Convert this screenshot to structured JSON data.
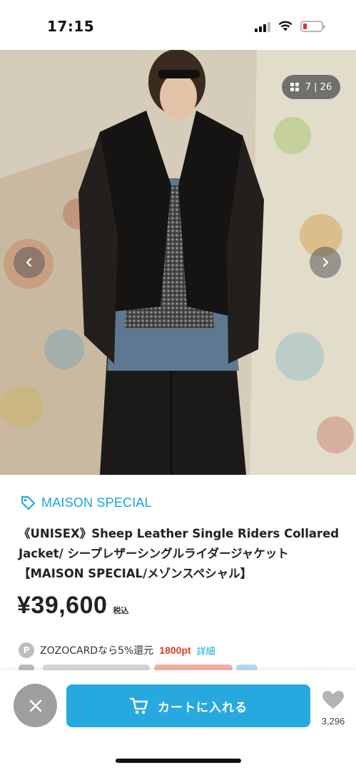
{
  "status_bar": {
    "time": "17:15"
  },
  "gallery": {
    "counter": "7 | 26",
    "icons": [
      "grid-icon",
      "chevron-left-icon",
      "chevron-right-icon"
    ]
  },
  "product": {
    "brand": "MAISON SPECIAL",
    "brand_icon": "tag-icon",
    "title_lines": [
      "《UNISEX》Sheep Leather Single Riders Collared",
      "Jacket/ シープレザーシングルライダージャケット",
      "【MAISON SPECIAL/メゾンスペシャル】"
    ],
    "price": "¥39,600",
    "tax_label": "税込"
  },
  "points": {
    "badge": "P",
    "text": "ZOZOCARDなら5%還元",
    "amount": "1800pt",
    "link": "詳細"
  },
  "actions": {
    "cart_label": "カートに入れる",
    "favorite_count": "3,296"
  },
  "colors": {
    "accent": "#27a9df",
    "brand_text": "#1aa3d9",
    "points_red": "#e23b2a",
    "close_gray": "#9e9e9e"
  }
}
